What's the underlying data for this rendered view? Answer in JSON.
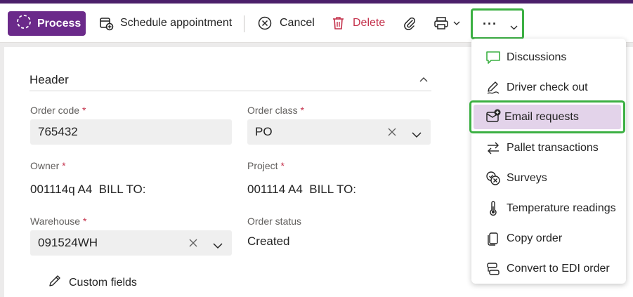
{
  "toolbar": {
    "process_label": "Process",
    "schedule_label": "Schedule appointment",
    "cancel_label": "Cancel",
    "delete_label": "Delete",
    "more_label": "···"
  },
  "header": {
    "title": "Header"
  },
  "fields": {
    "order_code": {
      "label": "Order code",
      "required": "*",
      "value": "765432"
    },
    "order_class": {
      "label": "Order class",
      "required": "*",
      "value": "PO"
    },
    "owner": {
      "label": "Owner",
      "required": "*",
      "value": "001114q A4  BILL TO:"
    },
    "project": {
      "label": "Project",
      "required": "*",
      "value": "001114 A4  BILL TO:"
    },
    "warehouse": {
      "label": "Warehouse",
      "required": "*",
      "value": "091524WH"
    },
    "order_status": {
      "label": "Order status",
      "value": "Created"
    }
  },
  "custom_fields_label": "Custom fields",
  "menu": {
    "items": [
      {
        "label": "Discussions",
        "icon": "chat-icon"
      },
      {
        "label": "Driver check out",
        "icon": "signature-icon"
      },
      {
        "label": "Email requests",
        "icon": "mail-add-icon"
      },
      {
        "label": "Pallet transactions",
        "icon": "arrows-swap-icon"
      },
      {
        "label": "Surveys",
        "icon": "survey-icon"
      },
      {
        "label": "Temperature readings",
        "icon": "thermometer-icon"
      },
      {
        "label": "Copy order",
        "icon": "copy-icon"
      },
      {
        "label": "Convert to EDI order",
        "icon": "convert-icon"
      }
    ]
  },
  "colors": {
    "brand": "#6b2a8a",
    "highlight_border": "#3cb043",
    "highlight_fill": "#e3d3ea",
    "delete": "#c4314b"
  }
}
